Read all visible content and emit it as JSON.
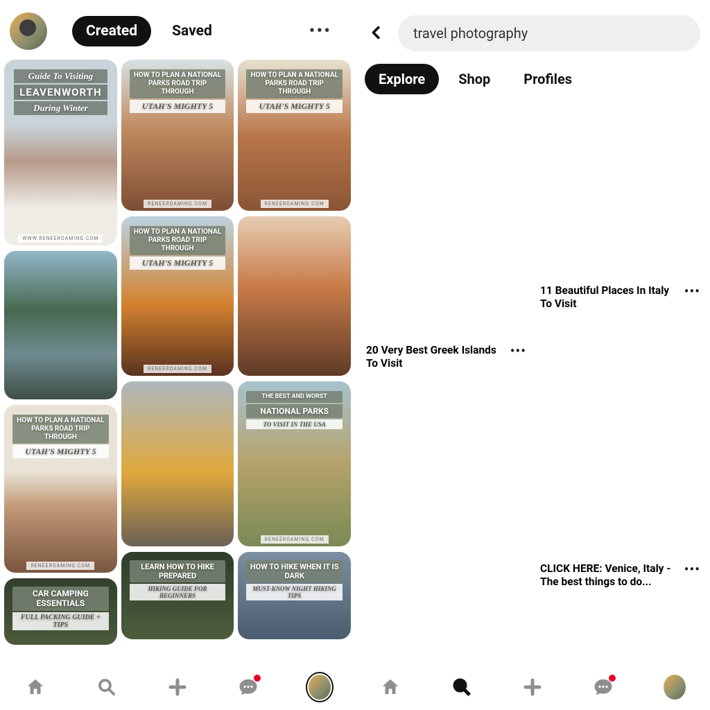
{
  "left": {
    "tabs": {
      "created": "Created",
      "saved": "Saved"
    },
    "more_icon": "more-options",
    "pins": {
      "col1": [
        {
          "title_line1": "Guide To Visiting",
          "title_line2": "LEAVENWORTH",
          "title_line3": "During Winter",
          "footer": "WWW.RENEEROAMING.COM"
        },
        {
          "footer": ""
        },
        {
          "banner": "HOW TO PLAN A NATIONAL PARKS ROAD TRIP THROUGH",
          "subtitle": "UTAH'S MIGHTY 5",
          "footer": "RENEEROAMING.COM"
        },
        {
          "banner": "CAR CAMPING ESSENTIALS",
          "subtitle": "FULL PACKING GUIDE + TIPS"
        }
      ],
      "col2": [
        {
          "banner": "HOW TO PLAN A NATIONAL PARKS ROAD TRIP THROUGH",
          "subtitle": "UTAH'S MIGHTY 5",
          "footer": "RENEEROAMING.COM"
        },
        {
          "banner": "HOW TO PLAN A NATIONAL PARKS ROAD TRIP THROUGH",
          "subtitle": "UTAH'S MIGHTY 5",
          "footer": "RENEEROAMING.COM"
        },
        {
          "footer": ""
        },
        {
          "banner": "LEARN HOW TO HIKE PREPARED",
          "subtitle": "HIKING GUIDE FOR BEGINNERS"
        }
      ],
      "col3": [
        {
          "banner": "HOW TO PLAN A NATIONAL PARKS ROAD TRIP THROUGH",
          "subtitle": "UTAH'S MIGHTY 5",
          "footer": "RENEEROAMING.COM"
        },
        {
          "footer": ""
        },
        {
          "banner": "THE BEST AND WORST",
          "banner2": "NATIONAL PARKS",
          "subtitle": "TO VISIT IN THE USA",
          "footer": "RENEEROAMING.COM"
        },
        {
          "banner": "HOW TO HIKE WHEN IT IS DARK",
          "subtitle": "MUST-KNOW NIGHT HIKING TIPS"
        }
      ]
    }
  },
  "right": {
    "search_value": "travel photography",
    "filters": {
      "explore": "Explore",
      "shop": "Shop",
      "profiles": "Profiles"
    },
    "pins": {
      "col1": [
        {
          "title": "20 Very Best Greek Islands To Visit"
        },
        {
          "title": ""
        }
      ],
      "col2": [
        {
          "title": "11 Beautiful Places In Italy To Visit"
        },
        {
          "title": "CLICK HERE: Venice, Italy - The best things to do..."
        },
        {
          "title": ""
        }
      ]
    }
  },
  "nav": {
    "home": "home-icon",
    "search": "search-icon",
    "add": "add-icon",
    "chat": "chat-icon",
    "profile": "profile-avatar"
  }
}
